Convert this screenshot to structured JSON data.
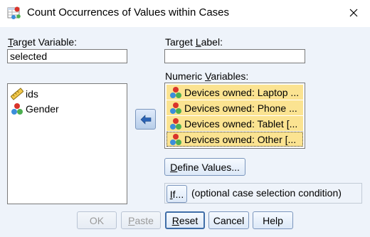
{
  "window": {
    "title": "Count Occurrences of Values within Cases",
    "icon": "spss-dialog-icon",
    "close_icon": "close-icon"
  },
  "target_variable": {
    "label_underlined": "T",
    "label_rest": "arget Variable:",
    "value": "selected"
  },
  "target_label": {
    "label_pre": "Target ",
    "label_underlined": "L",
    "label_rest": "abel:",
    "value": ""
  },
  "source_list": {
    "items": [
      {
        "label": "ids",
        "icon": "scale-ruler-icon"
      },
      {
        "label": "Gender",
        "icon": "nominal-balls-icon"
      }
    ]
  },
  "move_button": {
    "icon": "arrow-left-icon"
  },
  "numeric_variables": {
    "label_pre": "Numeric ",
    "label_underlined": "V",
    "label_rest": "ariables:",
    "items": [
      {
        "label": "Devices owned: Laptop ...",
        "icon": "nominal-balls-icon"
      },
      {
        "label": "Devices owned: Phone ...",
        "icon": "nominal-balls-icon"
      },
      {
        "label": "Devices owned: Tablet [...",
        "icon": "nominal-balls-icon"
      },
      {
        "label": "Devices owned: Other [...",
        "icon": "nominal-balls-icon"
      }
    ]
  },
  "define_values": {
    "underlined": "D",
    "rest": "efine Values..."
  },
  "if_section": {
    "button_underlined": "I",
    "button_rest": "f...",
    "description": "(optional case selection condition)"
  },
  "buttons": {
    "ok": "OK",
    "paste_underlined": "P",
    "paste_rest": "aste",
    "reset_underlined": "R",
    "reset_rest": "eset",
    "cancel": "Cancel",
    "help": "Help"
  },
  "colors": {
    "dialog_bg": "#eef3fa",
    "selected_item_bg": "#fbe391",
    "button_border": "#7b96bd",
    "disabled_text": "#9a9a9a"
  }
}
